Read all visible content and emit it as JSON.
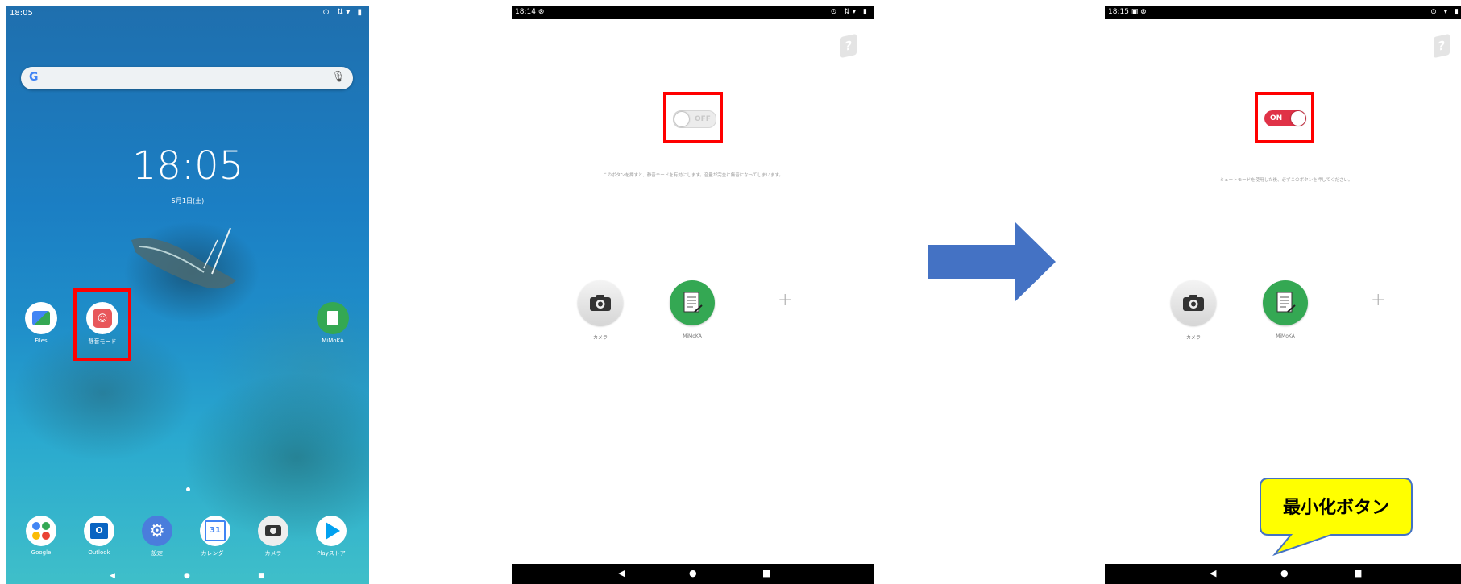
{
  "panel1": {
    "status_time": "18:05",
    "status_icons": "⊙ ⇅▾ ▮",
    "search": {
      "g_logo": "G",
      "mic": "🎙"
    },
    "clock": "18:05",
    "date": "5月1日(土)",
    "apps": [
      {
        "label": "Files"
      },
      {
        "label": "静音モード"
      },
      {
        "label": "MiMoKA"
      }
    ],
    "dock": [
      {
        "label": "Google"
      },
      {
        "label": "Outlook"
      },
      {
        "label": "設定"
      },
      {
        "label": "カレンダー"
      },
      {
        "label": "カメラ"
      },
      {
        "label": "Playストア"
      }
    ],
    "calendar_day": "31",
    "nav": {
      "back": "◀",
      "home": "●",
      "recent": "■"
    }
  },
  "panel2": {
    "status_time": "18:14",
    "status_extra": "⊗",
    "status_icons": "⊙ ⇅▾ ▮",
    "help_icon": "?",
    "toggle_text": "OFF",
    "description": "このボタンを押すと、静音モードを有効にします。音量が完全に無音になってしまいます。",
    "camera_label": "カメラ",
    "mimoka_label": "MiMoKA",
    "plus": "+",
    "nav": {
      "back": "◀",
      "home": "●",
      "recent": "■"
    }
  },
  "panel3": {
    "status_time": "18:15",
    "status_extra": "▣ ⊗",
    "status_icons": "⊙ ▾ ▮",
    "help_icon": "?",
    "toggle_text": "ON",
    "description": "ミュートモードを使用した後、必ずこのボタンを押してください。",
    "camera_label": "カメラ",
    "mimoka_label": "MiMoKA",
    "plus": "+",
    "nav": {
      "back": "◀",
      "home": "●",
      "recent": "■"
    }
  },
  "callout": {
    "text": "最小化ボタン"
  },
  "colors": {
    "highlight": "#ff0000",
    "toggle_on": "#e03247",
    "arrow": "#4472c4",
    "callout_fill": "#ffff00",
    "callout_border": "#4472c4"
  }
}
